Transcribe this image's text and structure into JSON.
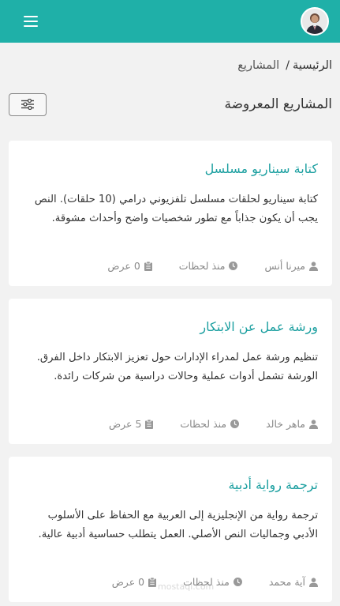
{
  "breadcrumb": {
    "home": "الرئيسية",
    "separator": "/",
    "current": "المشاريع"
  },
  "page": {
    "title": "المشاريع المعروضة"
  },
  "icons": {
    "menu": "hamburger-icon",
    "filter": "sliders-icon",
    "user": "user-icon",
    "time": "clock-icon",
    "offers": "clipboard-icon"
  },
  "colors": {
    "brand": "#1fb0a8",
    "link": "#1b9fa0"
  },
  "projects": [
    {
      "title": "كتابة سيناريو مسلسل",
      "description": "كتابة سيناريو لحلقات مسلسل تلفزيوني درامي (10 حلقات). النص يجب أن يكون جذاباً مع تطور شخصيات واضح وأحداث مشوقة.",
      "owner": "ميرنا أنس",
      "time": "منذ لحظات",
      "offers": "0 عرض"
    },
    {
      "title": "ورشة عمل عن الابتكار",
      "description": "تنظيم ورشة عمل لمدراء الإدارات حول تعزيز الابتكار داخل الفرق. الورشة تشمل أدوات عملية وحالات دراسية من شركات رائدة.",
      "owner": "ماهر خالد",
      "time": "منذ لحظات",
      "offers": "5 عرض"
    },
    {
      "title": "ترجمة رواية أدبية",
      "description": "ترجمة رواية من الإنجليزية إلى العربية مع الحفاظ على الأسلوب الأدبي وجماليات النص الأصلي. العمل يتطلب حساسية أدبية عالية.",
      "owner": "آية محمد",
      "time": "منذ لحظات",
      "offers": "0 عرض"
    }
  ],
  "watermark": "mostaql.com"
}
